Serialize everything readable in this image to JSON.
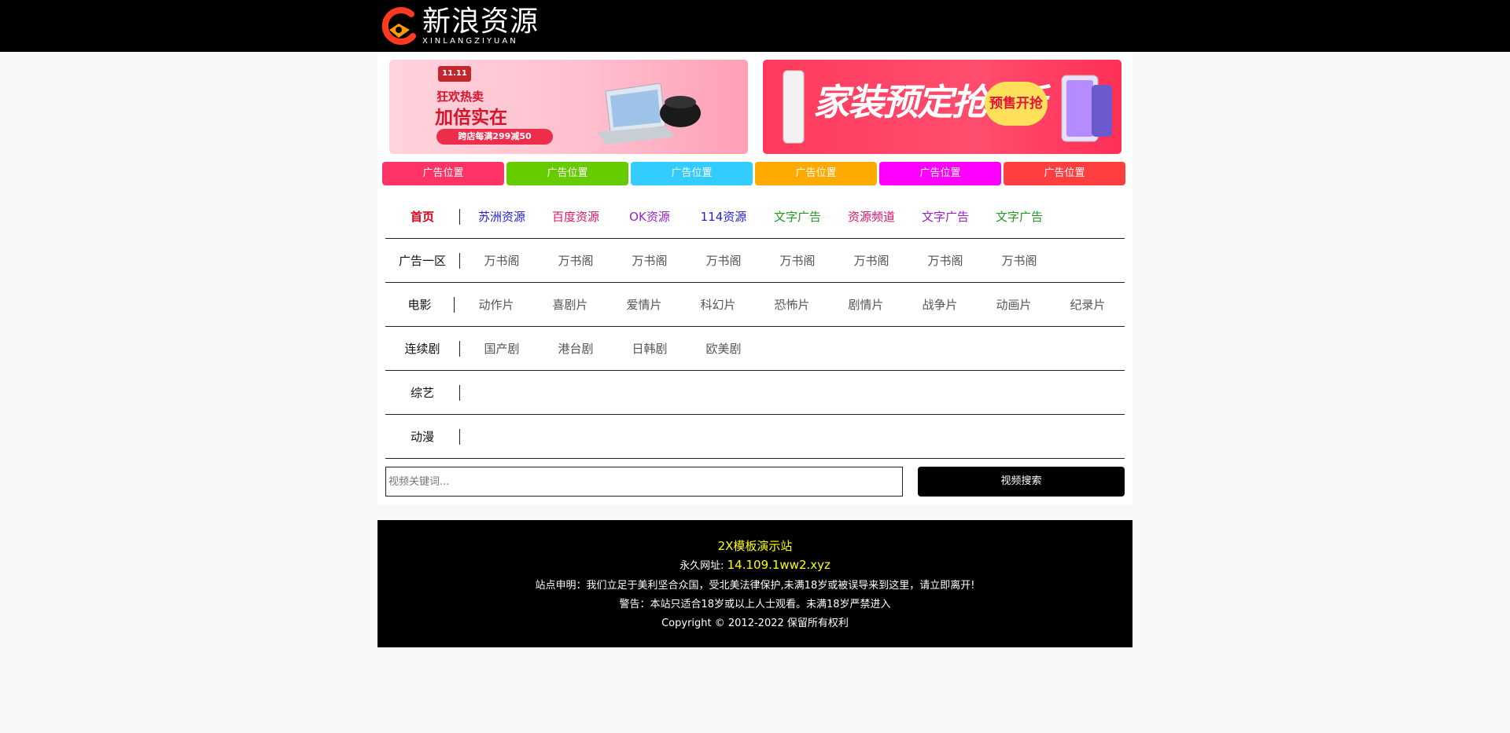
{
  "logo": {
    "title": "新浪资源",
    "subtitle": "XINLANGZIYUAN"
  },
  "banners": {
    "left": {
      "badge": "11.11",
      "line1": "狂欢热卖",
      "line2": "加倍实在",
      "pill": "跨店每满299减50"
    },
    "right": {
      "headline": "家装预定抢5折",
      "badge": "预售开抢"
    }
  },
  "ads": [
    {
      "label": "广告位置",
      "color": "#ff3366"
    },
    {
      "label": "广告位置",
      "color": "#66cc00"
    },
    {
      "label": "广告位置",
      "color": "#33ccff"
    },
    {
      "label": "广告位置",
      "color": "#ffaa00"
    },
    {
      "label": "广告位置",
      "color": "#ff00ff"
    },
    {
      "label": "广告位置",
      "color": "#ff3f3f"
    }
  ],
  "nav": {
    "home": {
      "label": "首页",
      "links": [
        {
          "text": "苏洲资源",
          "color": "#2222dd"
        },
        {
          "text": "百度资源",
          "color": "#e0156b"
        },
        {
          "text": "OK资源",
          "color": "#9922cc"
        },
        {
          "text": "114资源",
          "color": "#2222dd"
        },
        {
          "text": "文字广告",
          "color": "#229922"
        },
        {
          "text": "资源频道",
          "color": "#e0156b"
        },
        {
          "text": "文字广告",
          "color": "#9922cc"
        },
        {
          "text": "文字广告",
          "color": "#229922"
        }
      ]
    },
    "ad1": {
      "label": "广告一区",
      "links": [
        "万书阁",
        "万书阁",
        "万书阁",
        "万书阁",
        "万书阁",
        "万书阁",
        "万书阁",
        "万书阁"
      ]
    },
    "movie": {
      "label": "电影",
      "links": [
        "动作片",
        "喜剧片",
        "爱情片",
        "科幻片",
        "恐怖片",
        "剧情片",
        "战争片",
        "动画片",
        "纪录片"
      ]
    },
    "series": {
      "label": "连续剧",
      "links": [
        "国产剧",
        "港台剧",
        "日韩剧",
        "欧美剧"
      ]
    },
    "variety": {
      "label": "综艺",
      "links": []
    },
    "anime": {
      "label": "动漫",
      "links": []
    }
  },
  "search": {
    "placeholder": "视频关键词...",
    "button": "视频搜索"
  },
  "footer": {
    "title": "2X模板演示站",
    "url_label": "永久网址:",
    "url": "14.109.1ww2.xyz",
    "statement": "站点申明：我们立足于美利坚合众国，受北美法律保护,未满18岁或被误导来到这里，请立即离开!",
    "warning": "警告：本站只适合18岁或以上人士观看。未满18岁严禁进入",
    "copyright": "Copyright © 2012-2022 保留所有权利"
  }
}
